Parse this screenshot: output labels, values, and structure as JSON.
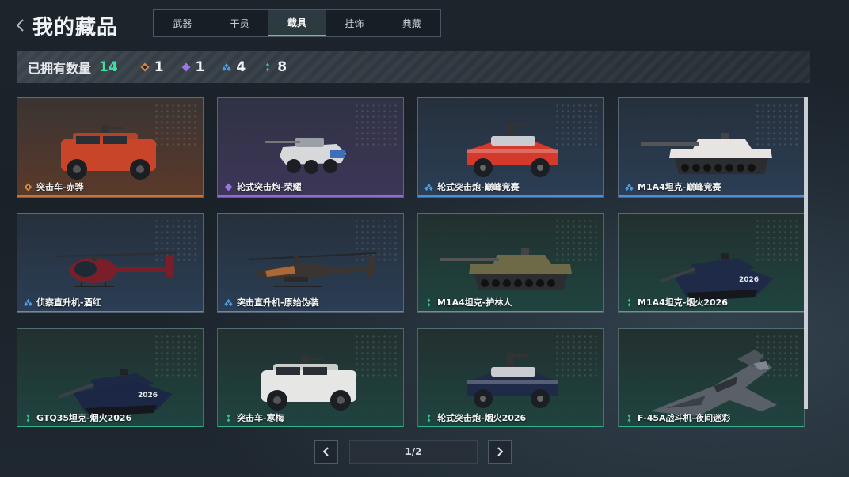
{
  "header": {
    "title": "我的藏品",
    "tabs": [
      {
        "label": "武器",
        "active": false
      },
      {
        "label": "干员",
        "active": false
      },
      {
        "label": "载具",
        "active": true
      },
      {
        "label": "挂饰",
        "active": false
      },
      {
        "label": "典藏",
        "active": false
      }
    ]
  },
  "summary": {
    "owned_label": "已拥有数量",
    "owned_total": "14",
    "rarity_counts": [
      {
        "rarity": "orange",
        "icon": "orange-diamond-icon",
        "color": "#d9883f",
        "count": "1"
      },
      {
        "rarity": "purple",
        "icon": "purple-diamond-icon",
        "color": "#9b74e6",
        "count": "1"
      },
      {
        "rarity": "blue",
        "icon": "blue-diamonds-icon",
        "color": "#4f9be0",
        "count": "4"
      },
      {
        "rarity": "green",
        "icon": "green-diamonds-icon",
        "color": "#35c49a",
        "count": "8"
      }
    ]
  },
  "items": [
    {
      "name": "突击车-赤骅",
      "rarity": "orange",
      "vehicle": "assault-car",
      "color": "#c8452a"
    },
    {
      "name": "轮式突击炮-荣耀",
      "rarity": "purple",
      "vehicle": "wheeled-gun",
      "color": "#d6d8da"
    },
    {
      "name": "轮式突击炮-巅峰竞赛",
      "rarity": "blue",
      "vehicle": "buggy",
      "color": "#d33a2c"
    },
    {
      "name": "M1A4坦克-巅峰竞赛",
      "rarity": "blue",
      "vehicle": "tank",
      "color": "#e8e4e2"
    },
    {
      "name": "侦察直升机-酒红",
      "rarity": "blue",
      "vehicle": "light-heli",
      "color": "#7a1e2a"
    },
    {
      "name": "突击直升机-原始伪装",
      "rarity": "blue",
      "vehicle": "attack-heli",
      "color": "#3a3530"
    },
    {
      "name": "M1A4坦克-护林人",
      "rarity": "green",
      "vehicle": "tank",
      "color": "#6e6a48"
    },
    {
      "name": "M1A4坦克-烟火2026",
      "rarity": "green",
      "vehicle": "tank-angled",
      "color": "#1f2a48"
    },
    {
      "name": "GTQ35坦克-烟火2026",
      "rarity": "green",
      "vehicle": "tank-angled",
      "color": "#1c2746"
    },
    {
      "name": "突击车-寒梅",
      "rarity": "green",
      "vehicle": "assault-car",
      "color": "#e6e6e4"
    },
    {
      "name": "轮式突击炮-烟火2026",
      "rarity": "green",
      "vehicle": "buggy",
      "color": "#1f2a48"
    },
    {
      "name": "F-45A战斗机-夜间迷彩",
      "rarity": "green",
      "vehicle": "jet",
      "color": "#5a6068"
    }
  ],
  "pagination": {
    "page_text": "1/2"
  },
  "colors": {
    "accent": "#3fd2a4",
    "orange": "#d9883f",
    "purple": "#9b74e6",
    "blue": "#4f9be0",
    "green": "#35c49a"
  }
}
